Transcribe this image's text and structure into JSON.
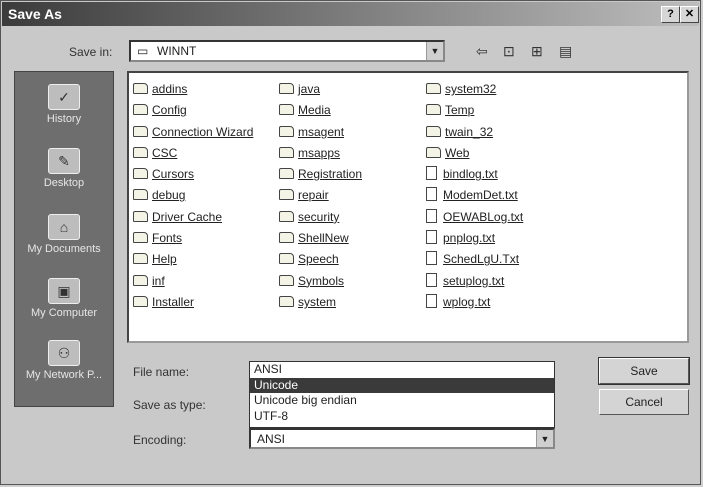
{
  "window": {
    "title": "Save As",
    "help_label": "?",
    "close_label": "✕"
  },
  "toolbar": {
    "save_in_label": "Save in:",
    "current_folder": "WINNT"
  },
  "places": [
    {
      "label": "History",
      "icon": "history-icon"
    },
    {
      "label": "Desktop",
      "icon": "desktop-icon"
    },
    {
      "label": "My Documents",
      "icon": "my-documents-icon"
    },
    {
      "label": "My Computer",
      "icon": "my-computer-icon"
    },
    {
      "label": "My Network P...",
      "icon": "network-icon"
    }
  ],
  "files": {
    "col1": [
      {
        "name": "addins",
        "type": "folder"
      },
      {
        "name": "Config",
        "type": "folder"
      },
      {
        "name": "Connection Wizard",
        "type": "folder"
      },
      {
        "name": "CSC",
        "type": "folder"
      },
      {
        "name": "Cursors",
        "type": "folder"
      },
      {
        "name": "debug",
        "type": "folder"
      },
      {
        "name": "Driver Cache",
        "type": "folder"
      },
      {
        "name": "Fonts",
        "type": "folder"
      },
      {
        "name": "Help",
        "type": "folder"
      },
      {
        "name": "inf",
        "type": "folder"
      },
      {
        "name": "Installer",
        "type": "folder"
      }
    ],
    "col2": [
      {
        "name": "java",
        "type": "folder"
      },
      {
        "name": "Media",
        "type": "folder"
      },
      {
        "name": "msagent",
        "type": "folder"
      },
      {
        "name": "msapps",
        "type": "folder"
      },
      {
        "name": "Registration",
        "type": "folder"
      },
      {
        "name": "repair",
        "type": "folder"
      },
      {
        "name": "security",
        "type": "folder"
      },
      {
        "name": "ShellNew",
        "type": "folder"
      },
      {
        "name": "Speech",
        "type": "folder"
      },
      {
        "name": "Symbols",
        "type": "folder"
      },
      {
        "name": "system",
        "type": "folder"
      }
    ],
    "col3": [
      {
        "name": "system32",
        "type": "folder"
      },
      {
        "name": "Temp",
        "type": "folder"
      },
      {
        "name": "twain_32",
        "type": "folder"
      },
      {
        "name": "Web",
        "type": "folder"
      },
      {
        "name": "bindlog.txt",
        "type": "file"
      },
      {
        "name": "ModemDet.txt",
        "type": "file"
      },
      {
        "name": "OEWABLog.txt",
        "type": "file"
      },
      {
        "name": "pnplog.txt",
        "type": "file"
      },
      {
        "name": "SchedLgU.Txt",
        "type": "file"
      },
      {
        "name": "setuplog.txt",
        "type": "file"
      },
      {
        "name": "wplog.txt",
        "type": "file"
      }
    ]
  },
  "form": {
    "file_name_label": "File name:",
    "save_as_type_label": "Save as type:",
    "encoding_label": "Encoding:",
    "encoding_value": "ANSI",
    "encoding_options": [
      "ANSI",
      "Unicode",
      "Unicode big endian",
      "UTF-8"
    ],
    "encoding_highlighted": "Unicode"
  },
  "buttons": {
    "save_label": "Save",
    "cancel_label": "Cancel"
  }
}
